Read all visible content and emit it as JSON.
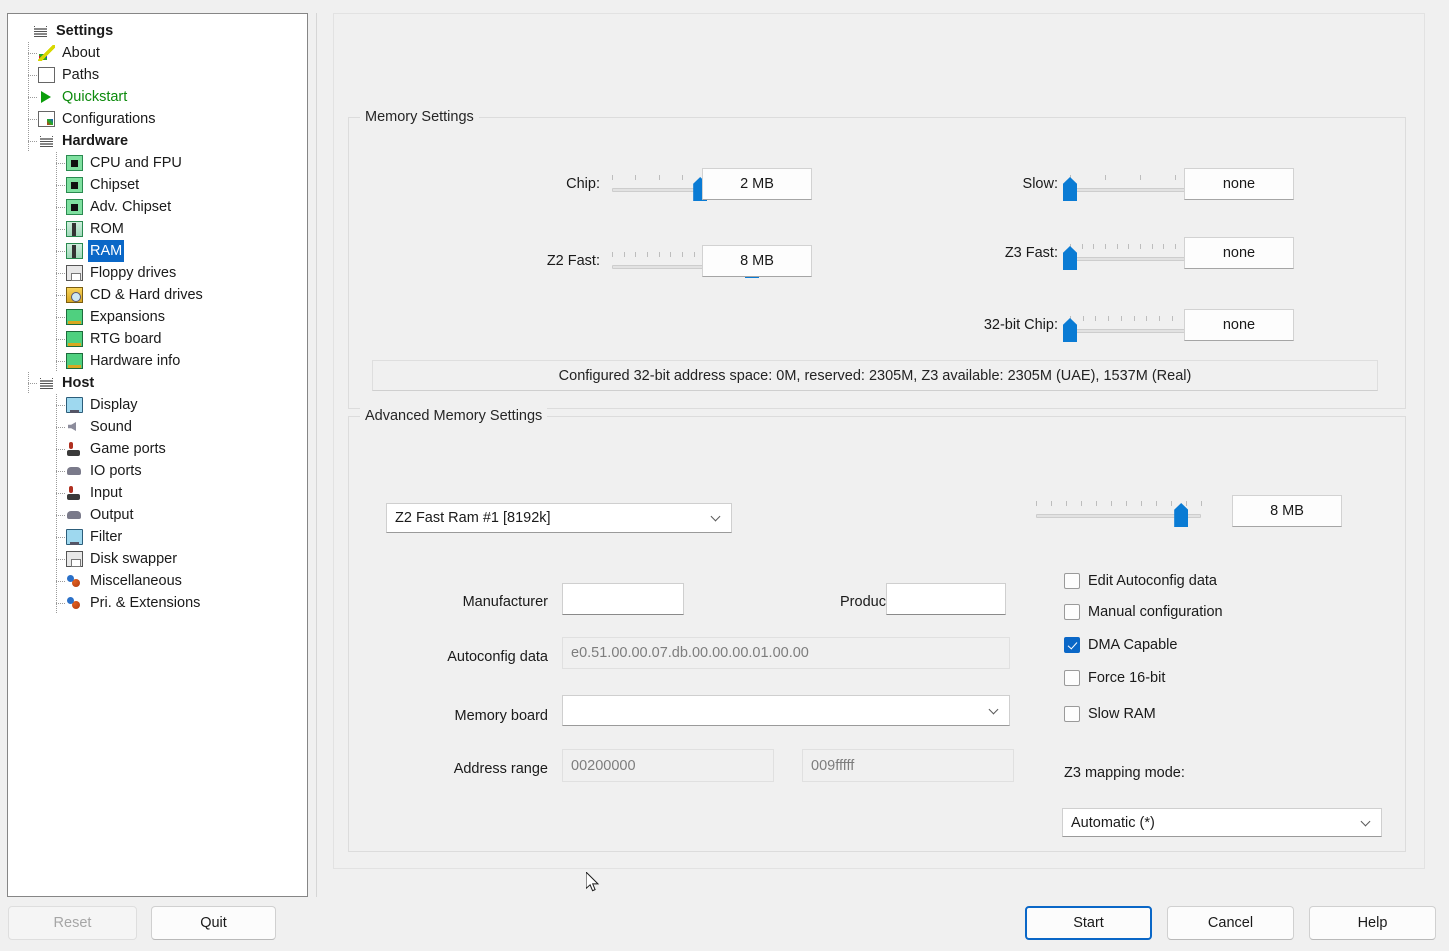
{
  "window": {
    "tree_title": "Settings"
  },
  "sidebar": {
    "items": [
      {
        "label": "Settings",
        "icon": "stack-icon",
        "level": 0,
        "bold": true,
        "selected": false
      },
      {
        "label": "About",
        "icon": "pencil-icon",
        "level": 1,
        "bold": false,
        "selected": false
      },
      {
        "label": "Paths",
        "icon": "paths-icon",
        "level": 1,
        "bold": false,
        "selected": false
      },
      {
        "label": "Quickstart",
        "icon": "play-icon",
        "level": 1,
        "bold": false,
        "selected": false
      },
      {
        "label": "Configurations",
        "icon": "config-icon",
        "level": 1,
        "bold": false,
        "selected": false
      },
      {
        "label": "Hardware",
        "icon": "stack-icon",
        "level": 1,
        "bold": true,
        "selected": false
      },
      {
        "label": "CPU and FPU",
        "icon": "chip-icon",
        "level": 2,
        "bold": false,
        "selected": false
      },
      {
        "label": "Chipset",
        "icon": "chip-icon",
        "level": 2,
        "bold": false,
        "selected": false
      },
      {
        "label": "Adv. Chipset",
        "icon": "chip-icon",
        "level": 2,
        "bold": false,
        "selected": false
      },
      {
        "label": "ROM",
        "icon": "ram-icon",
        "level": 2,
        "bold": false,
        "selected": false
      },
      {
        "label": "RAM",
        "icon": "ram-icon",
        "level": 2,
        "bold": false,
        "selected": true
      },
      {
        "label": "Floppy drives",
        "icon": "floppy-icon",
        "level": 2,
        "bold": false,
        "selected": false
      },
      {
        "label": "CD & Hard drives",
        "icon": "cd-hd-icon",
        "level": 2,
        "bold": false,
        "selected": false
      },
      {
        "label": "Expansions",
        "icon": "card-icon",
        "level": 2,
        "bold": false,
        "selected": false
      },
      {
        "label": "RTG board",
        "icon": "card-icon",
        "level": 2,
        "bold": false,
        "selected": false
      },
      {
        "label": "Hardware info",
        "icon": "card-icon",
        "level": 2,
        "bold": false,
        "selected": false
      },
      {
        "label": "Host",
        "icon": "stack-icon",
        "level": 1,
        "bold": true,
        "selected": false
      },
      {
        "label": "Display",
        "icon": "monitor-icon",
        "level": 2,
        "bold": false,
        "selected": false
      },
      {
        "label": "Sound",
        "icon": "sound-icon",
        "level": 2,
        "bold": false,
        "selected": false
      },
      {
        "label": "Game ports",
        "icon": "joystick-icon",
        "level": 2,
        "bold": false,
        "selected": false
      },
      {
        "label": "IO ports",
        "icon": "io-icon",
        "level": 2,
        "bold": false,
        "selected": false
      },
      {
        "label": "Input",
        "icon": "joystick-icon",
        "level": 2,
        "bold": false,
        "selected": false
      },
      {
        "label": "Output",
        "icon": "io-icon",
        "level": 2,
        "bold": false,
        "selected": false
      },
      {
        "label": "Filter",
        "icon": "monitor-icon",
        "level": 2,
        "bold": false,
        "selected": false
      },
      {
        "label": "Disk swapper",
        "icon": "floppy-icon",
        "level": 2,
        "bold": false,
        "selected": false
      },
      {
        "label": "Miscellaneous",
        "icon": "misc-icon",
        "level": 2,
        "bold": false,
        "selected": false
      },
      {
        "label": "Pri. & Extensions",
        "icon": "misc-icon",
        "level": 2,
        "bold": false,
        "selected": false
      }
    ]
  },
  "memory_settings": {
    "group_title": "Memory Settings",
    "sliders": [
      {
        "label": "Chip:",
        "value": "2 MB",
        "ticks": 7,
        "percent": 63
      },
      {
        "label": "Z2 Fast:",
        "value": "8 MB",
        "ticks": 13,
        "percent": 100
      },
      {
        "label": "Slow:",
        "value": "none",
        "ticks": 5,
        "percent": 0
      },
      {
        "label": "Z3 Fast:",
        "value": "none",
        "ticks": 13,
        "percent": 0
      },
      {
        "label": "32-bit Chip:",
        "value": "none",
        "ticks": 12,
        "percent": 0
      }
    ],
    "status": "Configured 32-bit address space: 0M, reserved: 2305M, Z3 available: 2305M (UAE), 1537M (Real)"
  },
  "advanced_memory": {
    "group_title": "Advanced Memory Settings",
    "board_select": "Z2 Fast Ram #1 [8192k]",
    "size_slider": {
      "value": "8 MB",
      "ticks": 12,
      "percent": 88
    },
    "manufacturer_label": "Manufacturer",
    "manufacturer_value": "",
    "product_label": "Product",
    "product_value": "",
    "autoconfig_label": "Autoconfig data",
    "autoconfig_value": "e0.51.00.00.07.db.00.00.00.01.00.00",
    "memory_board_label": "Memory board",
    "memory_board_value": "",
    "address_range_label": "Address range",
    "address_start": "00200000",
    "address_end": "009fffff",
    "checkboxes": [
      {
        "label": "Edit Autoconfig data",
        "checked": false
      },
      {
        "label": "Manual configuration",
        "checked": false
      },
      {
        "label": "DMA Capable",
        "checked": true
      },
      {
        "label": "Force 16-bit",
        "checked": false
      },
      {
        "label": "Slow RAM",
        "checked": false
      }
    ],
    "z3_mapping_label": "Z3 mapping mode:",
    "z3_mapping_value": "Automatic (*)"
  },
  "footer": {
    "reset_label": "Reset",
    "quit_label": "Quit",
    "start_label": "Start",
    "cancel_label": "Cancel",
    "help_label": "Help"
  },
  "colors": {
    "accent": "#0a7bd4",
    "selection": "#0a67c7",
    "window_bg": "#f0f0f0"
  }
}
